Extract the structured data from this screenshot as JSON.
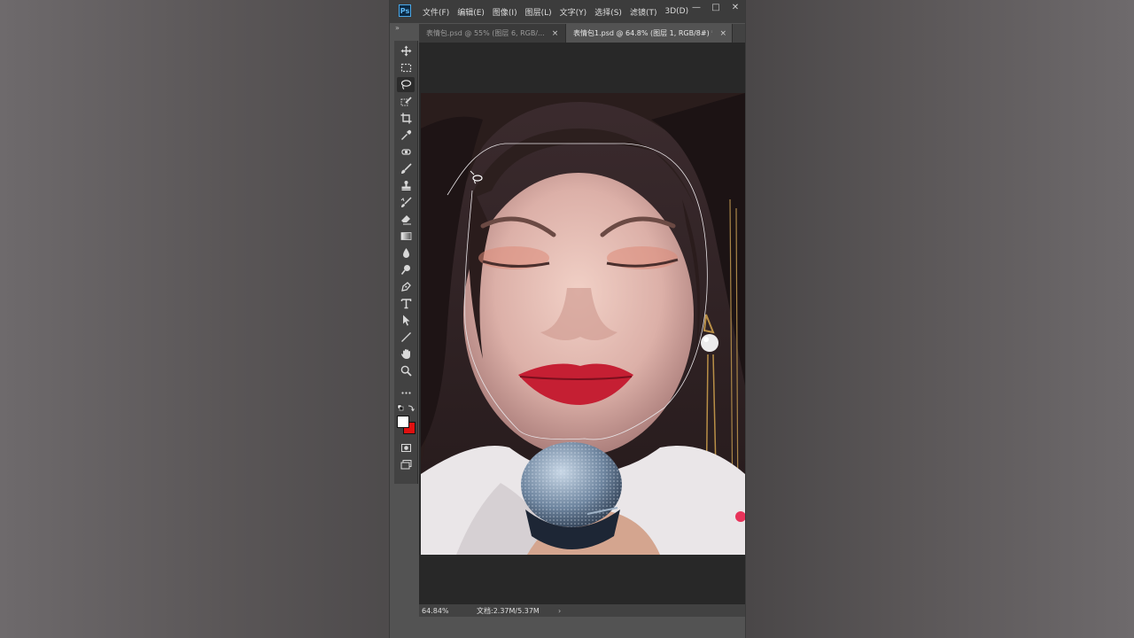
{
  "app": {
    "logo_text": "Ps",
    "menus": [
      "文件(F)",
      "编辑(E)",
      "图像(I)",
      "图层(L)",
      "文字(Y)",
      "选择(S)",
      "滤镜(T)",
      "3D(D)"
    ],
    "window_controls": [
      "—",
      "□",
      "✕"
    ]
  },
  "tabs": [
    {
      "label": "表情包.psd @ 55% (图层 6, RGB/...",
      "close": "×",
      "active": false
    },
    {
      "label": "表情包1.psd @ 64.8% (图层 1, RGB/8#) *",
      "close": "×",
      "active": true
    }
  ],
  "panel_collapse": "»",
  "tools": [
    {
      "name": "move-tool",
      "icon": "move-icon"
    },
    {
      "name": "marquee-tool",
      "icon": "marquee-icon"
    },
    {
      "name": "lasso-tool",
      "icon": "lasso-icon",
      "active": true
    },
    {
      "name": "quick-selection-tool",
      "icon": "quick-selection-icon"
    },
    {
      "name": "crop-tool",
      "icon": "crop-icon"
    },
    {
      "name": "eyedropper-tool",
      "icon": "eyedropper-icon"
    },
    {
      "name": "healing-brush-tool",
      "icon": "bandage-icon"
    },
    {
      "name": "brush-tool",
      "icon": "brush-icon"
    },
    {
      "name": "clone-stamp-tool",
      "icon": "stamp-icon"
    },
    {
      "name": "history-brush-tool",
      "icon": "history-brush-icon"
    },
    {
      "name": "eraser-tool",
      "icon": "eraser-icon"
    },
    {
      "name": "gradient-tool",
      "icon": "gradient-icon"
    },
    {
      "name": "blur-tool",
      "icon": "drop-icon"
    },
    {
      "name": "dodge-tool",
      "icon": "dodge-icon"
    },
    {
      "name": "pen-tool",
      "icon": "pen-icon"
    },
    {
      "name": "type-tool",
      "icon": "type-icon"
    },
    {
      "name": "path-selection-tool",
      "icon": "arrow-icon"
    },
    {
      "name": "line-tool",
      "icon": "line-icon"
    },
    {
      "name": "hand-tool",
      "icon": "hand-icon"
    },
    {
      "name": "zoom-tool",
      "icon": "zoom-icon"
    },
    {
      "name": "more-tools",
      "icon": "more-icon"
    }
  ],
  "colors": {
    "foreground": "#ffffff",
    "background": "#e01010",
    "chrome": "#535353",
    "menubar": "#3c3c3c",
    "canvas_bg": "#282828"
  },
  "status": {
    "zoom": "64.84%",
    "doc_info": "文档:2.37M/5.37M",
    "arrow": "›"
  }
}
